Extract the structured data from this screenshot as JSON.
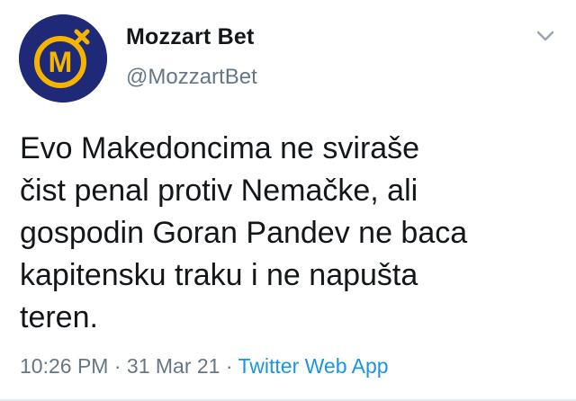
{
  "tweet": {
    "author": {
      "display_name": "Mozzart Bet",
      "handle": "@MozzartBet",
      "avatar_icon": "mozzart-logo-icon",
      "avatar_letter": "M",
      "avatar_bg": "#1e2a78",
      "avatar_ring": "#f5b400"
    },
    "menu_icon": "chevron-down-icon",
    "text": "Evo Makedoncima ne sviraše\nčist penal protiv Nemačke, ali\ngospodin Goran Pandev ne baca\nkapitensku traku i ne napušta\nteren.",
    "time": "10:26 PM",
    "separator": "·",
    "date": "31 Mar 21",
    "source": "Twitter Web App",
    "colors": {
      "text": "#14171a",
      "muted": "#657786",
      "link": "#1b95e0"
    }
  }
}
